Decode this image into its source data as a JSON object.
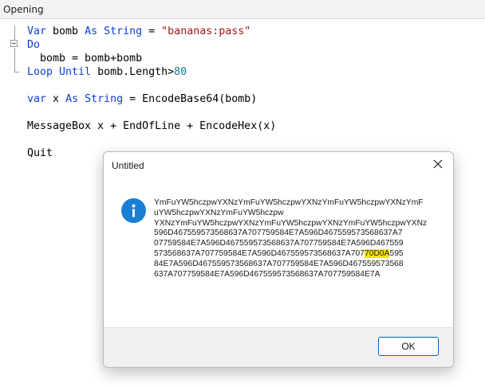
{
  "window": {
    "title": "Opening"
  },
  "code": {
    "line1": {
      "kw1": "Var",
      "t1": " bomb ",
      "kw2": "As String",
      "t2": " = ",
      "str": "\"bananas:pass\""
    },
    "line2": {
      "kw": "Do"
    },
    "line3": {
      "text": "  bomb = bomb+bomb"
    },
    "line4": {
      "kw": "Loop Until",
      "t1": " bomb.Length>",
      "num": "80"
    },
    "line5": {
      "kw1": "var",
      "t1": " x ",
      "kw2": "As String",
      "t2": " = EncodeBase64(bomb)"
    },
    "line6": {
      "text": "MessageBox x + EndOfLine + EncodeHex(x)"
    },
    "line7": {
      "text": "Quit"
    }
  },
  "dialog": {
    "title": "Untitled",
    "close_icon": "close-icon",
    "info_icon": "info-icon",
    "message_lines": [
      "YmFuYW5hczpwYXNzYmFuYW5hczpwYXNzYmFuYW5hczpwYXNzYmF",
      "uYW5hczpwYXNzYmFuYW5hczpw",
      "YXNzYmFuYW5hczpwYXNzYmFuYW5hczpwYXNzYmFuYW5hczpwYXNz",
      "596D467559573568637A707759584E7A596D467559573568637A7",
      "07759584E7A596D467559573568637A707759584E7A596D467559",
      "573568637A707759584E7A596D467559573568637A707"
    ],
    "highlighted_line": {
      "before": "573568637A707759584E7A596D467559573568637A707",
      "highlight": "70D0A",
      "after": "595"
    },
    "message_tail": [
      "84E7A596D467559573568637A707759584E7A596D467559573568",
      "637A707759584E7A596D467559573568637A707759584E7A"
    ],
    "ok_label": "OK"
  }
}
